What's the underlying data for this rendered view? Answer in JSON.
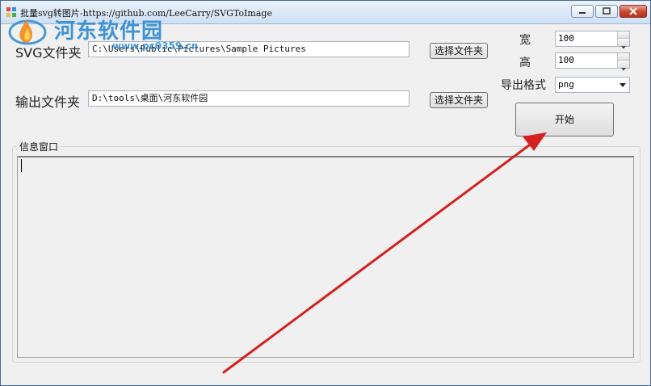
{
  "window": {
    "title": "批量svg转图片-https://github.com/LeeCarry/SVGToImage",
    "controls": [
      "minimize",
      "maximize",
      "close"
    ]
  },
  "watermark": {
    "brand": "河东软件园",
    "url": "www.pc0359.cn",
    "icon": "flame-logo-icon"
  },
  "form": {
    "svg_folder_label": "SVG文件夹",
    "svg_folder_value": "C:\\Users\\Public\\Pictures\\Sample Pictures",
    "output_folder_label": "输出文件夹",
    "output_folder_value": "D:\\tools\\桌面\\河东软件园",
    "browse_label": "选择文件夹",
    "width_label": "宽",
    "width_value": "100",
    "height_label": "高",
    "height_value": "100",
    "format_label": "导出格式",
    "format_value": "png",
    "start_label": "开始"
  },
  "log": {
    "title": "信息窗口",
    "content": ""
  },
  "colors": {
    "accent": "#2d8ad1",
    "annotation_arrow": "#d42020",
    "window_bg": "#f0f0f0"
  }
}
